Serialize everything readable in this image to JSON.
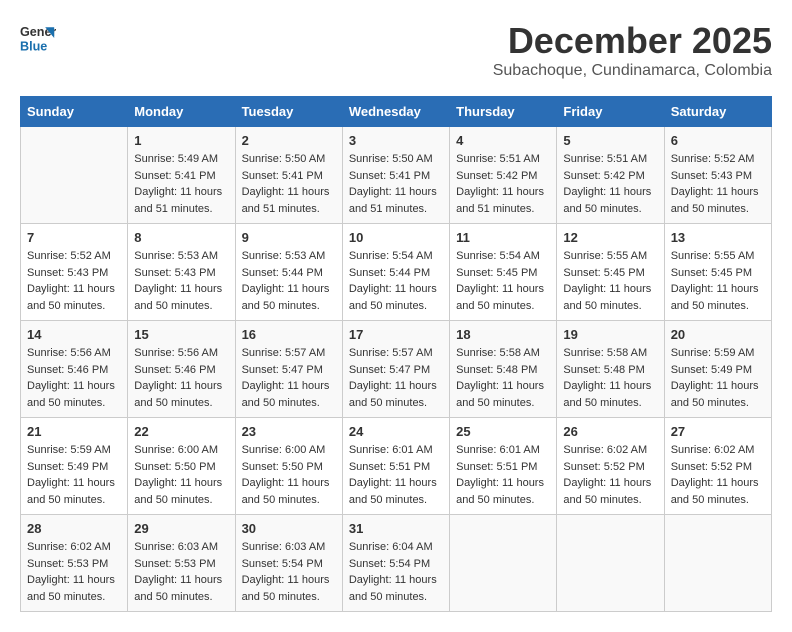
{
  "header": {
    "logo_line1": "General",
    "logo_line2": "Blue",
    "month_title": "December 2025",
    "subtitle": "Subachoque, Cundinamarca, Colombia"
  },
  "weekdays": [
    "Sunday",
    "Monday",
    "Tuesday",
    "Wednesday",
    "Thursday",
    "Friday",
    "Saturday"
  ],
  "weeks": [
    [
      {
        "day": "",
        "info": ""
      },
      {
        "day": "1",
        "info": "Sunrise: 5:49 AM\nSunset: 5:41 PM\nDaylight: 11 hours\nand 51 minutes."
      },
      {
        "day": "2",
        "info": "Sunrise: 5:50 AM\nSunset: 5:41 PM\nDaylight: 11 hours\nand 51 minutes."
      },
      {
        "day": "3",
        "info": "Sunrise: 5:50 AM\nSunset: 5:41 PM\nDaylight: 11 hours\nand 51 minutes."
      },
      {
        "day": "4",
        "info": "Sunrise: 5:51 AM\nSunset: 5:42 PM\nDaylight: 11 hours\nand 51 minutes."
      },
      {
        "day": "5",
        "info": "Sunrise: 5:51 AM\nSunset: 5:42 PM\nDaylight: 11 hours\nand 50 minutes."
      },
      {
        "day": "6",
        "info": "Sunrise: 5:52 AM\nSunset: 5:43 PM\nDaylight: 11 hours\nand 50 minutes."
      }
    ],
    [
      {
        "day": "7",
        "info": "Sunrise: 5:52 AM\nSunset: 5:43 PM\nDaylight: 11 hours\nand 50 minutes."
      },
      {
        "day": "8",
        "info": "Sunrise: 5:53 AM\nSunset: 5:43 PM\nDaylight: 11 hours\nand 50 minutes."
      },
      {
        "day": "9",
        "info": "Sunrise: 5:53 AM\nSunset: 5:44 PM\nDaylight: 11 hours\nand 50 minutes."
      },
      {
        "day": "10",
        "info": "Sunrise: 5:54 AM\nSunset: 5:44 PM\nDaylight: 11 hours\nand 50 minutes."
      },
      {
        "day": "11",
        "info": "Sunrise: 5:54 AM\nSunset: 5:45 PM\nDaylight: 11 hours\nand 50 minutes."
      },
      {
        "day": "12",
        "info": "Sunrise: 5:55 AM\nSunset: 5:45 PM\nDaylight: 11 hours\nand 50 minutes."
      },
      {
        "day": "13",
        "info": "Sunrise: 5:55 AM\nSunset: 5:45 PM\nDaylight: 11 hours\nand 50 minutes."
      }
    ],
    [
      {
        "day": "14",
        "info": "Sunrise: 5:56 AM\nSunset: 5:46 PM\nDaylight: 11 hours\nand 50 minutes."
      },
      {
        "day": "15",
        "info": "Sunrise: 5:56 AM\nSunset: 5:46 PM\nDaylight: 11 hours\nand 50 minutes."
      },
      {
        "day": "16",
        "info": "Sunrise: 5:57 AM\nSunset: 5:47 PM\nDaylight: 11 hours\nand 50 minutes."
      },
      {
        "day": "17",
        "info": "Sunrise: 5:57 AM\nSunset: 5:47 PM\nDaylight: 11 hours\nand 50 minutes."
      },
      {
        "day": "18",
        "info": "Sunrise: 5:58 AM\nSunset: 5:48 PM\nDaylight: 11 hours\nand 50 minutes."
      },
      {
        "day": "19",
        "info": "Sunrise: 5:58 AM\nSunset: 5:48 PM\nDaylight: 11 hours\nand 50 minutes."
      },
      {
        "day": "20",
        "info": "Sunrise: 5:59 AM\nSunset: 5:49 PM\nDaylight: 11 hours\nand 50 minutes."
      }
    ],
    [
      {
        "day": "21",
        "info": "Sunrise: 5:59 AM\nSunset: 5:49 PM\nDaylight: 11 hours\nand 50 minutes."
      },
      {
        "day": "22",
        "info": "Sunrise: 6:00 AM\nSunset: 5:50 PM\nDaylight: 11 hours\nand 50 minutes."
      },
      {
        "day": "23",
        "info": "Sunrise: 6:00 AM\nSunset: 5:50 PM\nDaylight: 11 hours\nand 50 minutes."
      },
      {
        "day": "24",
        "info": "Sunrise: 6:01 AM\nSunset: 5:51 PM\nDaylight: 11 hours\nand 50 minutes."
      },
      {
        "day": "25",
        "info": "Sunrise: 6:01 AM\nSunset: 5:51 PM\nDaylight: 11 hours\nand 50 minutes."
      },
      {
        "day": "26",
        "info": "Sunrise: 6:02 AM\nSunset: 5:52 PM\nDaylight: 11 hours\nand 50 minutes."
      },
      {
        "day": "27",
        "info": "Sunrise: 6:02 AM\nSunset: 5:52 PM\nDaylight: 11 hours\nand 50 minutes."
      }
    ],
    [
      {
        "day": "28",
        "info": "Sunrise: 6:02 AM\nSunset: 5:53 PM\nDaylight: 11 hours\nand 50 minutes."
      },
      {
        "day": "29",
        "info": "Sunrise: 6:03 AM\nSunset: 5:53 PM\nDaylight: 11 hours\nand 50 minutes."
      },
      {
        "day": "30",
        "info": "Sunrise: 6:03 AM\nSunset: 5:54 PM\nDaylight: 11 hours\nand 50 minutes."
      },
      {
        "day": "31",
        "info": "Sunrise: 6:04 AM\nSunset: 5:54 PM\nDaylight: 11 hours\nand 50 minutes."
      },
      {
        "day": "",
        "info": ""
      },
      {
        "day": "",
        "info": ""
      },
      {
        "day": "",
        "info": ""
      }
    ]
  ]
}
